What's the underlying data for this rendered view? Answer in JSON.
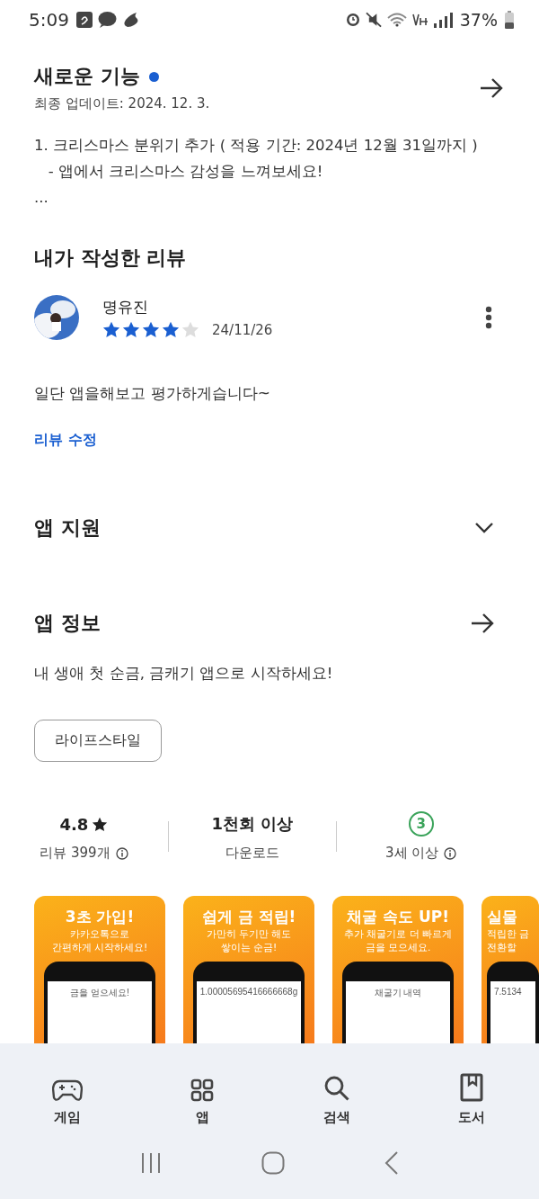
{
  "status_bar": {
    "time": "5:09",
    "battery": "37%"
  },
  "whats_new": {
    "title": "새로운 기능",
    "unread": true,
    "updated": "최종 업데이트: 2024. 12. 3.",
    "lines": [
      "1. 크리스마스 분위기 추가 ( 적용 기간: 2024년 12월 31일까지 )",
      "   - 앱에서 크리스마스 감성을 느껴보세요!",
      "..."
    ]
  },
  "my_review": {
    "title": "내가 작성한 리뷰",
    "author": "명유진",
    "stars": 4,
    "date": "24/11/26",
    "text": "일단 앱을해보고 평가하게습니다~",
    "edit_link": "리뷰 수정"
  },
  "app_support": {
    "title": "앱 지원",
    "expanded": false
  },
  "app_info": {
    "title": "앱 정보",
    "description": "내 생애 첫 순금, 금캐기 앱으로 시작하세요!",
    "category": "라이프스타일"
  },
  "stats": [
    {
      "kind": "rating",
      "value": "4.8",
      "label": "리뷰 399개"
    },
    {
      "kind": "plain",
      "value": "1천회 이상",
      "label": "다운로드"
    },
    {
      "kind": "age",
      "value": "3",
      "label": "3세 이상"
    }
  ],
  "screenshots": [
    {
      "headline": "3초 가입!",
      "subtitle": [
        "카카오톡으로",
        "간편하게 시작하세요!"
      ],
      "screen_text": "금을 얻으세요!"
    },
    {
      "headline": "쉽게 금 적립!",
      "subtitle": [
        "가만히 두기만 해도",
        "쌓이는 순금!"
      ],
      "screen_text": "1.00005695416666668g"
    },
    {
      "headline": "채굴 속도 UP!",
      "subtitle": [
        "추가 채굴기로 더 빠르게",
        "금을 모으세요."
      ],
      "screen_text": "채굴기 내역"
    },
    {
      "headline": "실물",
      "subtitle": [
        "적립한 금",
        "전환할"
      ],
      "screen_text": "7.5134"
    }
  ],
  "bottom_nav": [
    {
      "label": "게임",
      "selected": false
    },
    {
      "label": "앱",
      "selected": false
    },
    {
      "label": "검색",
      "selected": false
    },
    {
      "label": "도서",
      "selected": false
    }
  ]
}
